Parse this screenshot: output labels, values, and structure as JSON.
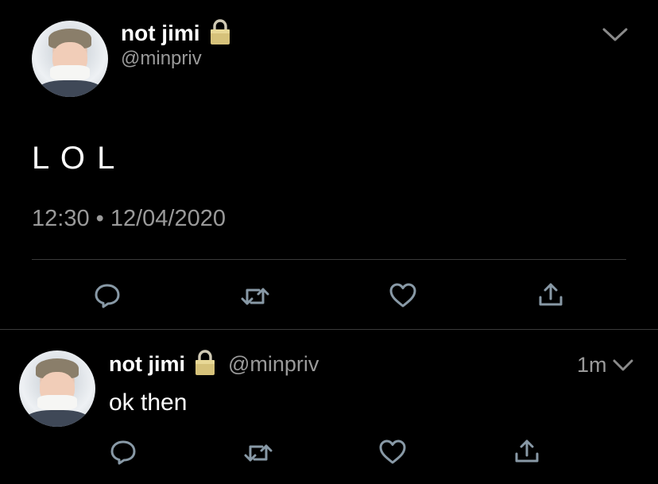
{
  "main_tweet": {
    "display_name": "not jimi",
    "handle": "@minpriv",
    "text": "L O L",
    "timestamp": "12:30 • 12/04/2020"
  },
  "reply_tweet": {
    "display_name": "not jimi",
    "handle": "@minpriv",
    "time_ago": "1m",
    "text": "ok then"
  },
  "icons": {
    "reply": "reply-icon",
    "retweet": "retweet-icon",
    "like": "heart-icon",
    "share": "share-icon",
    "more": "chevron-down-icon",
    "lock": "lock-icon"
  },
  "colors": {
    "background": "#000000",
    "action_icon": "#8899a6",
    "secondary_text": "#9a9a9a",
    "divider": "#3a3a3a"
  }
}
